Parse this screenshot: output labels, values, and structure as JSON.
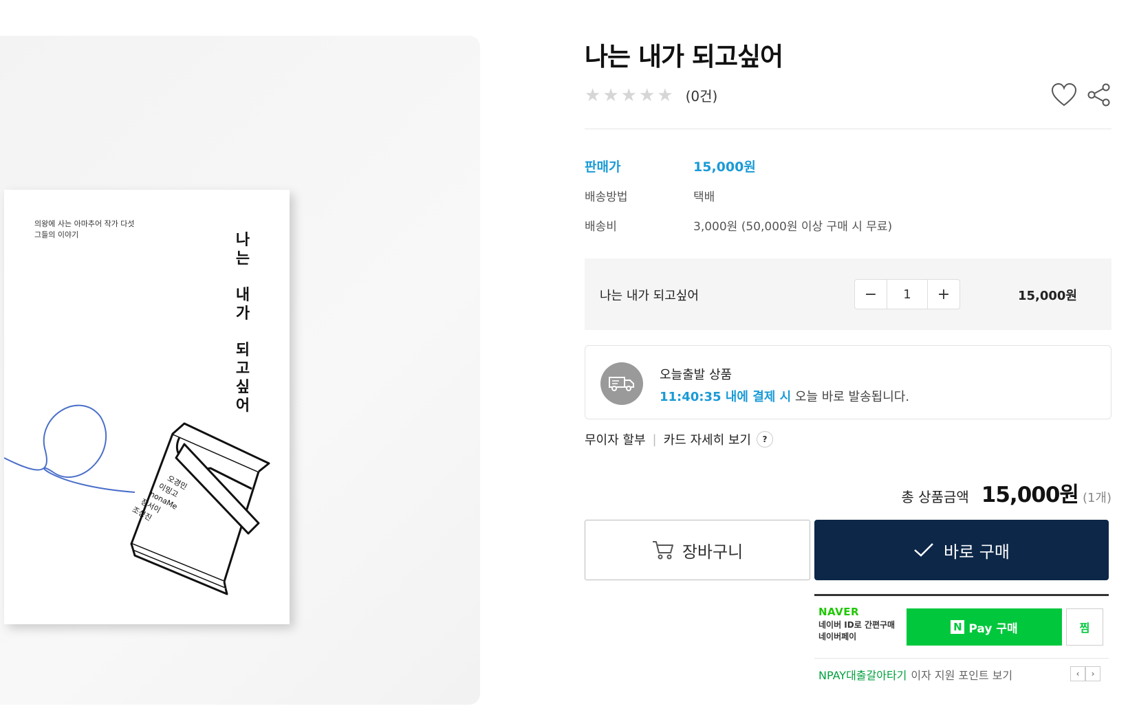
{
  "book_cover": {
    "subtitle_line1": "의왕에 사는 아마추어 작가 다섯",
    "subtitle_line2": "그들의 이야기",
    "title_chars_1": [
      "나",
      "는"
    ],
    "title_chars_2": [
      "내",
      "가"
    ],
    "title_chars_3": [
      "되",
      "고",
      "싶",
      "어"
    ],
    "authors": [
      "오경민",
      "이밍고",
      "nonaMe",
      "장서이",
      "조성진"
    ]
  },
  "product": {
    "title": "나는 내가 되고싶어",
    "rating_stars": 0,
    "review_count": "(0건)"
  },
  "specs": {
    "price_label": "판매가",
    "price_value": "15,000원",
    "shipping_method_label": "배송방법",
    "shipping_method_value": "택배",
    "shipping_fee_label": "배송비",
    "shipping_fee_value": "3,000원 (50,000원 이상 구매 시 무료)"
  },
  "option": {
    "name": "나는 내가 되고싶어",
    "minus": "−",
    "quantity": "1",
    "plus": "+",
    "price": "15,000원"
  },
  "shipping_notice": {
    "title": "오늘출발 상품",
    "highlight": "11:40:35 내에 결제 시",
    "rest": " 오늘 바로 발송됩니다."
  },
  "card_info": {
    "installment": "무이자 할부",
    "separator": "|",
    "details": "카드 자세히 보기",
    "help": "?"
  },
  "total": {
    "label": "총 상품금액",
    "value": "15,000원",
    "qty": "(1개)"
  },
  "buttons": {
    "cart": "장바구니",
    "buy": "바로 구매"
  },
  "npay": {
    "logo": "NAVER",
    "desc_line1": "네이버 ID로 간편구매",
    "desc_line2": "네이버페이",
    "n_letter": "N",
    "pay_label": "Pay 구매",
    "zzim": "찜",
    "promo_green": "NPAY대출갈아타기",
    "promo_gray": "이자 지원 포인트 보기",
    "prev": "‹",
    "next": "›"
  },
  "colors": {
    "accent_blue": "#1a9ad6",
    "buy_navy": "#0c2748",
    "naver_green": "#00c73c"
  }
}
